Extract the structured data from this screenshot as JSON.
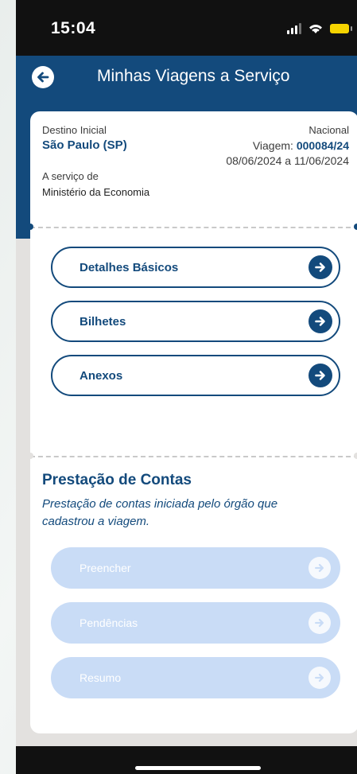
{
  "status_bar": {
    "time": "15:04"
  },
  "header": {
    "title": "Minhas Viagens a Serviço",
    "back_icon": "arrow-left-circle-icon"
  },
  "trip": {
    "destination_label": "Destino Inicial",
    "destination": "São Paulo (SP)",
    "type": "Nacional",
    "trip_label": "Viagem:",
    "trip_number": "000084/24",
    "dates": "08/06/2024 a 11/06/2024",
    "service_label": "A serviço de",
    "service_org": "Ministério da Economia"
  },
  "menu": {
    "items": [
      {
        "label": "Detalhes Básicos"
      },
      {
        "label": "Bilhetes"
      },
      {
        "label": "Anexos"
      }
    ]
  },
  "accountability": {
    "title": "Prestação de Contas",
    "subtitle": "Prestação de contas iniciada pelo órgão que cadastrou a viagem.",
    "items": [
      {
        "label": "Preencher"
      },
      {
        "label": "Pendências"
      },
      {
        "label": "Resumo"
      }
    ]
  },
  "colors": {
    "primary": "#134a7c",
    "disabled_button": "#c9dcf6",
    "battery": "#f6d400"
  }
}
